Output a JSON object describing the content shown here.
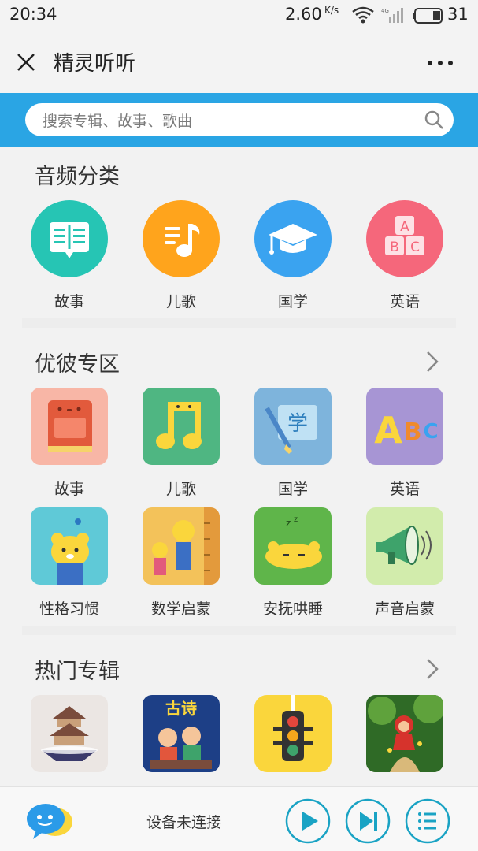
{
  "status_bar": {
    "time": "20:34",
    "speed": "2.60",
    "speed_unit": "K/s",
    "battery": "31",
    "network": "4G"
  },
  "nav": {
    "title": "精灵听听",
    "close_icon": "close-icon",
    "more_icon": "more-icon"
  },
  "search": {
    "placeholder": "搜索专辑、故事、歌曲"
  },
  "audio_categories": {
    "title": "音频分类",
    "items": [
      {
        "label": "故事",
        "icon": "book-icon",
        "color": "#26c5b4"
      },
      {
        "label": "儿歌",
        "icon": "music-note-icon",
        "color": "#ffa41c"
      },
      {
        "label": "国学",
        "icon": "graduation-cap-icon",
        "color": "#3aa3f0"
      },
      {
        "label": "英语",
        "icon": "abc-blocks-icon",
        "color": "#f5677b"
      }
    ]
  },
  "youbi_zone": {
    "title": "优彼专区",
    "rows": [
      [
        {
          "label": "故事"
        },
        {
          "label": "儿歌"
        },
        {
          "label": "国学"
        },
        {
          "label": "英语"
        }
      ],
      [
        {
          "label": "性格习惯"
        },
        {
          "label": "数学启蒙"
        },
        {
          "label": "安抚哄睡"
        },
        {
          "label": "声音启蒙"
        }
      ]
    ]
  },
  "hot_albums": {
    "title": "热门专辑",
    "items": [
      {
        "text": ""
      },
      {
        "text": "古诗"
      },
      {
        "text": ""
      },
      {
        "text": ""
      }
    ]
  },
  "player": {
    "status": "设备未连接"
  }
}
